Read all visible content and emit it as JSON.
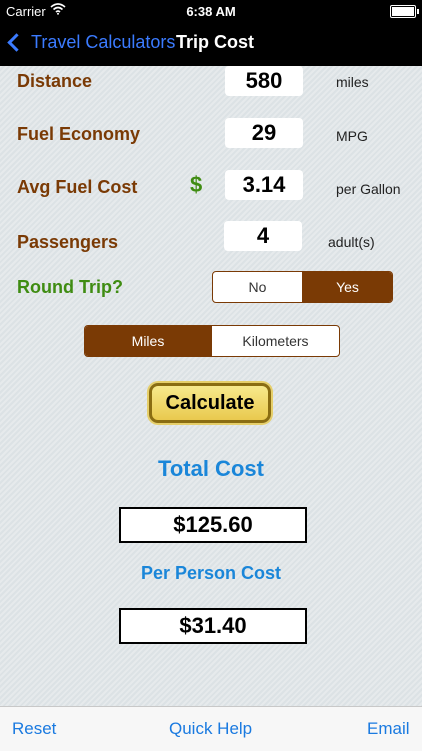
{
  "status_bar": {
    "carrier": "Carrier",
    "time": "6:38 AM"
  },
  "nav": {
    "back_label": "Travel Calculators",
    "title": "Trip Cost"
  },
  "form": {
    "distance": {
      "label": "Distance",
      "value": "580",
      "unit": "miles"
    },
    "fuel_economy": {
      "label": "Fuel Economy",
      "value": "29",
      "unit": "MPG"
    },
    "avg_fuel_cost": {
      "label": "Avg Fuel Cost",
      "currency": "$",
      "value": "3.14",
      "unit": "per Gallon"
    },
    "passengers": {
      "label": "Passengers",
      "value": "4",
      "unit": "adult(s)"
    },
    "round_trip": {
      "label": "Round Trip?",
      "options": [
        "No",
        "Yes"
      ],
      "selected": "Yes"
    },
    "units": {
      "options": [
        "Miles",
        "Kilometers"
      ],
      "selected": "Miles"
    }
  },
  "calculate_label": "Calculate",
  "results": {
    "total_heading": "Total Cost",
    "total_value": "$125.60",
    "per_person_heading": "Per Person Cost",
    "per_person_value": "$31.40"
  },
  "toolbar": {
    "reset": "Reset",
    "quick_help": "Quick Help",
    "email": "Email"
  },
  "colors": {
    "label_brown": "#7a3a05",
    "label_green": "#3f8c12",
    "accent_blue": "#1a86d9",
    "segment_selected": "#7a3a05"
  }
}
